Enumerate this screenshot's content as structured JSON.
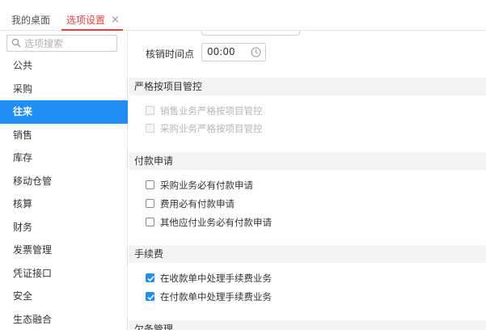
{
  "tabs": {
    "home_label": "我的桌面",
    "active_label": "选项设置",
    "close_glyph": "×"
  },
  "search": {
    "placeholder": "选项搜索"
  },
  "sidebar": {
    "items": [
      {
        "label": "公共",
        "active": false
      },
      {
        "label": "采购",
        "active": false
      },
      {
        "label": "往来",
        "active": true
      },
      {
        "label": "销售",
        "active": false
      },
      {
        "label": "库存",
        "active": false
      },
      {
        "label": "移动仓管",
        "active": false
      },
      {
        "label": "核算",
        "active": false
      },
      {
        "label": "财务",
        "active": false
      },
      {
        "label": "发票管理",
        "active": false
      },
      {
        "label": "凭证接口",
        "active": false
      },
      {
        "label": "安全",
        "active": false
      },
      {
        "label": "生态融合",
        "active": false
      }
    ]
  },
  "main": {
    "writeoff_time": {
      "label": "核销时间点",
      "value": "00:00"
    },
    "sections": {
      "strict_project": {
        "title": "严格按项目管控",
        "options": [
          {
            "label": "销售业务严格按项目管控",
            "checked": false,
            "disabled": true
          },
          {
            "label": "采购业务严格按项目管控",
            "checked": false,
            "disabled": true
          }
        ]
      },
      "payment_request": {
        "title": "付款申请",
        "options": [
          {
            "label": "采购业务必有付款申请",
            "checked": false,
            "disabled": false
          },
          {
            "label": "费用必有付款申请",
            "checked": false,
            "disabled": false
          },
          {
            "label": "其他应付业务必有付款申请",
            "checked": false,
            "disabled": false
          }
        ]
      },
      "fees": {
        "title": "手续费",
        "options": [
          {
            "label": "在收款单中处理手续费业务",
            "checked": true,
            "disabled": false
          },
          {
            "label": "在付款单中处理手续费业务",
            "checked": true,
            "disabled": false
          }
        ]
      },
      "debt": {
        "title": "欠条管理"
      }
    }
  },
  "colors": {
    "accent": "#1f8ff6",
    "tab_active": "#e8413d",
    "section_bg": "#f2f3f5"
  }
}
